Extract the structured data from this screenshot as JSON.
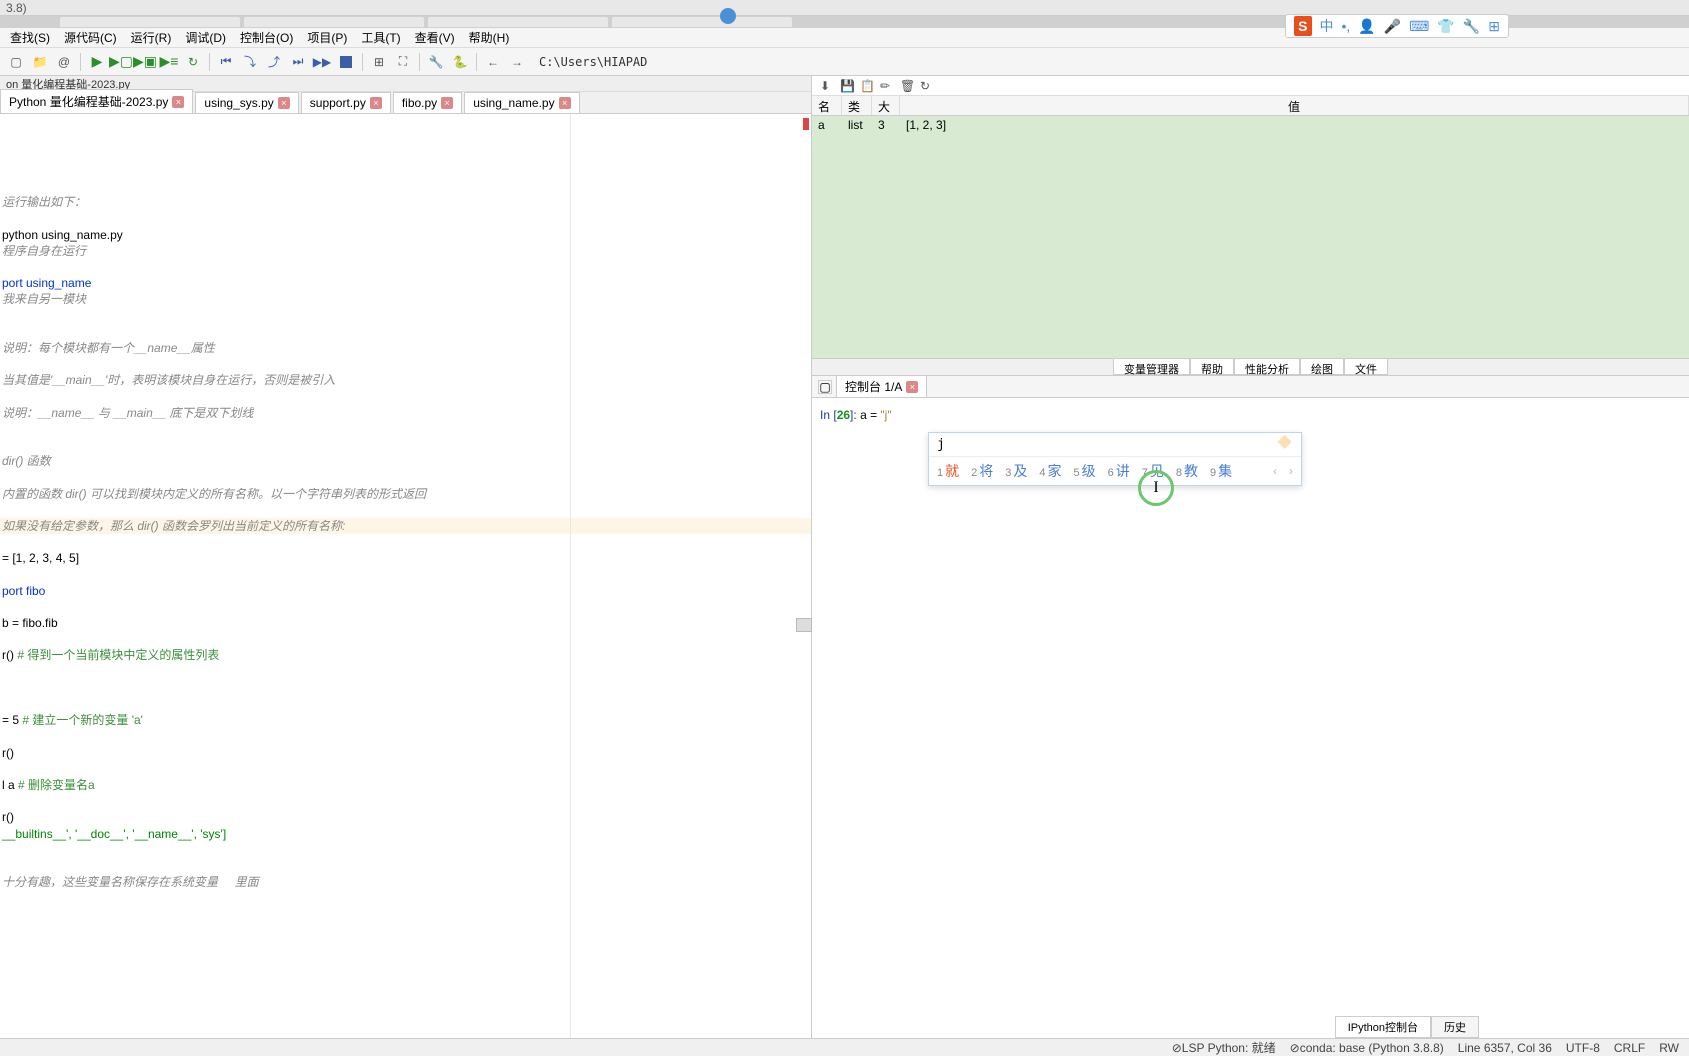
{
  "titlebar": {
    "text": "3.8)"
  },
  "menubar": {
    "items": [
      "查找(S)",
      "源代码(C)",
      "运行(R)",
      "调试(D)",
      "控制台(O)",
      "项目(P)",
      "工具(T)",
      "查看(V)",
      "帮助(H)"
    ]
  },
  "toolbar": {
    "path": "C:\\Users\\HIAPAD"
  },
  "file_path": "on 量化编程基础-2023.py",
  "tabs": [
    {
      "label": "Python 量化编程基础-2023.py",
      "active": true
    },
    {
      "label": "using_sys.py",
      "active": false
    },
    {
      "label": "support.py",
      "active": false
    },
    {
      "label": "fibo.py",
      "active": false
    },
    {
      "label": "using_name.py",
      "active": false
    }
  ],
  "editor_lines": [
    {
      "t": "",
      "c": ""
    },
    {
      "t": "运行输出如下：",
      "c": "comment-it"
    },
    {
      "t": "",
      "c": ""
    },
    {
      "t": "python using_name.py",
      "c": "name"
    },
    {
      "t": "程序自身在运行",
      "c": "comment-it"
    },
    {
      "t": "",
      "c": ""
    },
    {
      "t": "port using_name",
      "c": "kw"
    },
    {
      "t": "我来自另一模块",
      "c": "comment-it"
    },
    {
      "t": "",
      "c": ""
    },
    {
      "t": "",
      "c": ""
    },
    {
      "t": "说明：每个模块都有一个__name__属性",
      "c": "comment-it"
    },
    {
      "t": "",
      "c": ""
    },
    {
      "t": "当其值是'__main__'时，表明该模块自身在运行，否则是被引入",
      "c": "comment-it"
    },
    {
      "t": "",
      "c": ""
    },
    {
      "t": "说明：__name__ 与 __main__ 底下是双下划线",
      "c": "comment-it"
    },
    {
      "t": "",
      "c": ""
    },
    {
      "t": "",
      "c": ""
    },
    {
      "t": "dir() 函数",
      "c": "comment-it"
    },
    {
      "t": "",
      "c": ""
    },
    {
      "t": "内置的函数 dir() 可以找到模块内定义的所有名称。以一个字符串列表的形式返回",
      "c": "comment-it"
    },
    {
      "t": "",
      "c": ""
    },
    {
      "t": "如果没有给定参数，那么 dir() 函数会罗列出当前定义的所有名称:",
      "c": "comment-it",
      "hl": true
    },
    {
      "t": "",
      "c": ""
    },
    {
      "t": "= [1, 2, 3, 4, 5]",
      "c": "name"
    },
    {
      "t": "",
      "c": ""
    },
    {
      "t": "port fibo",
      "c": "kw"
    },
    {
      "t": "",
      "c": ""
    },
    {
      "t": "b = fibo.fib",
      "c": "name"
    },
    {
      "t": "",
      "c": ""
    },
    {
      "t": "r() # 得到一个当前模块中定义的属性列表",
      "c": "comment-gr-mix"
    },
    {
      "t": "",
      "c": ""
    },
    {
      "t": "",
      "c": ""
    },
    {
      "t": "",
      "c": ""
    },
    {
      "t": "= 5 # 建立一个新的变量 'a'",
      "c": "comment-gr-mix"
    },
    {
      "t": "",
      "c": ""
    },
    {
      "t": "r()",
      "c": "name"
    },
    {
      "t": "",
      "c": ""
    },
    {
      "t": "l a # 删除变量名a",
      "c": "comment-gr-mix"
    },
    {
      "t": "",
      "c": ""
    },
    {
      "t": "r()",
      "c": "name"
    },
    {
      "t": "__builtins__', '__doc__', '__name__', 'sys']",
      "c": "str"
    },
    {
      "t": "",
      "c": ""
    },
    {
      "t": "",
      "c": ""
    },
    {
      "t": "十分有趣，这些变量名称保存在系统变量     里面",
      "c": "comment-it"
    }
  ],
  "variables": {
    "headers": {
      "name": "名称",
      "type": "类型",
      "size": "大小",
      "value": "值"
    },
    "rows": [
      {
        "name": "a",
        "type": "list",
        "size": "3",
        "value": "[1, 2, 3]"
      }
    ]
  },
  "right_tabs": [
    "变量管理器",
    "帮助",
    "性能分析",
    "绘图",
    "文件"
  ],
  "console_tab": "控制台 1/A",
  "console": {
    "prompt_label": "In ",
    "prompt_num": "26",
    "prompt_close": "]: ",
    "code_prefix": "a = ",
    "code_str": "\"j\""
  },
  "ime": {
    "input": "j",
    "candidates": [
      {
        "n": "1",
        "c": "就",
        "sel": true
      },
      {
        "n": "2",
        "c": "将"
      },
      {
        "n": "3",
        "c": "及"
      },
      {
        "n": "4",
        "c": "家"
      },
      {
        "n": "5",
        "c": "级"
      },
      {
        "n": "6",
        "c": "讲"
      },
      {
        "n": "7",
        "c": "见"
      },
      {
        "n": "8",
        "c": "教"
      },
      {
        "n": "9",
        "c": "集"
      }
    ]
  },
  "ime_bar": {
    "label": "中"
  },
  "bottom_tabs": [
    "IPython控制台",
    "历史"
  ],
  "status": {
    "lsp": "⊘LSP Python: 就绪",
    "conda": "⊘conda: base (Python 3.8.8)",
    "pos": "Line 6357, Col 36",
    "enc": "UTF-8",
    "eol": "CRLF",
    "rw": "RW"
  }
}
